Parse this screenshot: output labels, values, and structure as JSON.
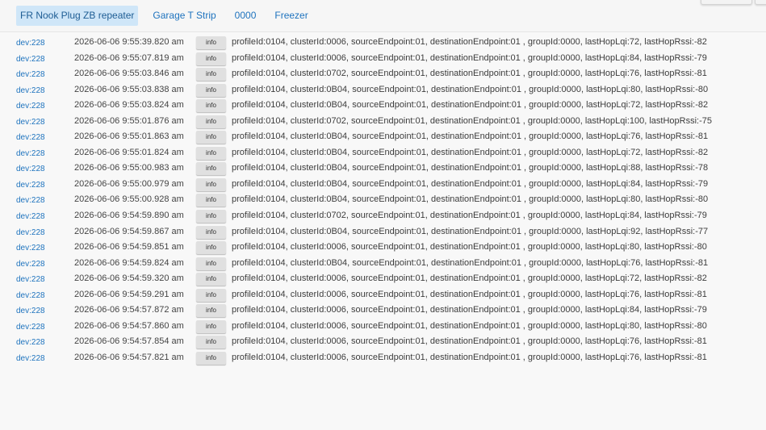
{
  "tabs": [
    {
      "label": "FR Nook Plug ZB repeater",
      "active": true
    },
    {
      "label": "Garage T Strip",
      "active": false
    },
    {
      "label": "0000",
      "active": false
    },
    {
      "label": "Freezer",
      "active": false
    }
  ],
  "log": [
    {
      "dev": "dev:228",
      "time": "2026-06-06 9:55:39.820 am",
      "level": "info",
      "msg": "profileId:0104, clusterId:0006, sourceEndpoint:01, destinationEndpoint:01 , groupId:0000, lastHopLqi:72, lastHopRssi:-82"
    },
    {
      "dev": "dev:228",
      "time": "2026-06-06 9:55:07.819 am",
      "level": "info",
      "msg": "profileId:0104, clusterId:0006, sourceEndpoint:01, destinationEndpoint:01 , groupId:0000, lastHopLqi:84, lastHopRssi:-79"
    },
    {
      "dev": "dev:228",
      "time": "2026-06-06 9:55:03.846 am",
      "level": "info",
      "msg": "profileId:0104, clusterId:0702, sourceEndpoint:01, destinationEndpoint:01 , groupId:0000, lastHopLqi:76, lastHopRssi:-81"
    },
    {
      "dev": "dev:228",
      "time": "2026-06-06 9:55:03.838 am",
      "level": "info",
      "msg": "profileId:0104, clusterId:0B04, sourceEndpoint:01, destinationEndpoint:01 , groupId:0000, lastHopLqi:80, lastHopRssi:-80"
    },
    {
      "dev": "dev:228",
      "time": "2026-06-06 9:55:03.824 am",
      "level": "info",
      "msg": "profileId:0104, clusterId:0B04, sourceEndpoint:01, destinationEndpoint:01 , groupId:0000, lastHopLqi:72, lastHopRssi:-82"
    },
    {
      "dev": "dev:228",
      "time": "2026-06-06 9:55:01.876 am",
      "level": "info",
      "msg": "profileId:0104, clusterId:0702, sourceEndpoint:01, destinationEndpoint:01 , groupId:0000, lastHopLqi:100, lastHopRssi:-75"
    },
    {
      "dev": "dev:228",
      "time": "2026-06-06 9:55:01.863 am",
      "level": "info",
      "msg": "profileId:0104, clusterId:0B04, sourceEndpoint:01, destinationEndpoint:01 , groupId:0000, lastHopLqi:76, lastHopRssi:-81"
    },
    {
      "dev": "dev:228",
      "time": "2026-06-06 9:55:01.824 am",
      "level": "info",
      "msg": "profileId:0104, clusterId:0B04, sourceEndpoint:01, destinationEndpoint:01 , groupId:0000, lastHopLqi:72, lastHopRssi:-82"
    },
    {
      "dev": "dev:228",
      "time": "2026-06-06 9:55:00.983 am",
      "level": "info",
      "msg": "profileId:0104, clusterId:0B04, sourceEndpoint:01, destinationEndpoint:01 , groupId:0000, lastHopLqi:88, lastHopRssi:-78"
    },
    {
      "dev": "dev:228",
      "time": "2026-06-06 9:55:00.979 am",
      "level": "info",
      "msg": "profileId:0104, clusterId:0B04, sourceEndpoint:01, destinationEndpoint:01 , groupId:0000, lastHopLqi:84, lastHopRssi:-79"
    },
    {
      "dev": "dev:228",
      "time": "2026-06-06 9:55:00.928 am",
      "level": "info",
      "msg": "profileId:0104, clusterId:0B04, sourceEndpoint:01, destinationEndpoint:01 , groupId:0000, lastHopLqi:80, lastHopRssi:-80"
    },
    {
      "dev": "dev:228",
      "time": "2026-06-06 9:54:59.890 am",
      "level": "info",
      "msg": "profileId:0104, clusterId:0702, sourceEndpoint:01, destinationEndpoint:01 , groupId:0000, lastHopLqi:84, lastHopRssi:-79"
    },
    {
      "dev": "dev:228",
      "time": "2026-06-06 9:54:59.867 am",
      "level": "info",
      "msg": "profileId:0104, clusterId:0B04, sourceEndpoint:01, destinationEndpoint:01 , groupId:0000, lastHopLqi:92, lastHopRssi:-77"
    },
    {
      "dev": "dev:228",
      "time": "2026-06-06 9:54:59.851 am",
      "level": "info",
      "msg": "profileId:0104, clusterId:0006, sourceEndpoint:01, destinationEndpoint:01 , groupId:0000, lastHopLqi:80, lastHopRssi:-80"
    },
    {
      "dev": "dev:228",
      "time": "2026-06-06 9:54:59.824 am",
      "level": "info",
      "msg": "profileId:0104, clusterId:0B04, sourceEndpoint:01, destinationEndpoint:01 , groupId:0000, lastHopLqi:76, lastHopRssi:-81"
    },
    {
      "dev": "dev:228",
      "time": "2026-06-06 9:54:59.320 am",
      "level": "info",
      "msg": "profileId:0104, clusterId:0006, sourceEndpoint:01, destinationEndpoint:01 , groupId:0000, lastHopLqi:72, lastHopRssi:-82"
    },
    {
      "dev": "dev:228",
      "time": "2026-06-06 9:54:59.291 am",
      "level": "info",
      "msg": "profileId:0104, clusterId:0006, sourceEndpoint:01, destinationEndpoint:01 , groupId:0000, lastHopLqi:76, lastHopRssi:-81"
    },
    {
      "dev": "dev:228",
      "time": "2026-06-06 9:54:57.872 am",
      "level": "info",
      "msg": "profileId:0104, clusterId:0006, sourceEndpoint:01, destinationEndpoint:01 , groupId:0000, lastHopLqi:84, lastHopRssi:-79"
    },
    {
      "dev": "dev:228",
      "time": "2026-06-06 9:54:57.860 am",
      "level": "info",
      "msg": "profileId:0104, clusterId:0006, sourceEndpoint:01, destinationEndpoint:01 , groupId:0000, lastHopLqi:80, lastHopRssi:-80"
    },
    {
      "dev": "dev:228",
      "time": "2026-06-06 9:54:57.854 am",
      "level": "info",
      "msg": "profileId:0104, clusterId:0006, sourceEndpoint:01, destinationEndpoint:01 , groupId:0000, lastHopLqi:76, lastHopRssi:-81"
    },
    {
      "dev": "dev:228",
      "time": "2026-06-06 9:54:57.821 am",
      "level": "info",
      "msg": "profileId:0104, clusterId:0006, sourceEndpoint:01, destinationEndpoint:01 , groupId:0000, lastHopLqi:76, lastHopRssi:-81"
    }
  ]
}
